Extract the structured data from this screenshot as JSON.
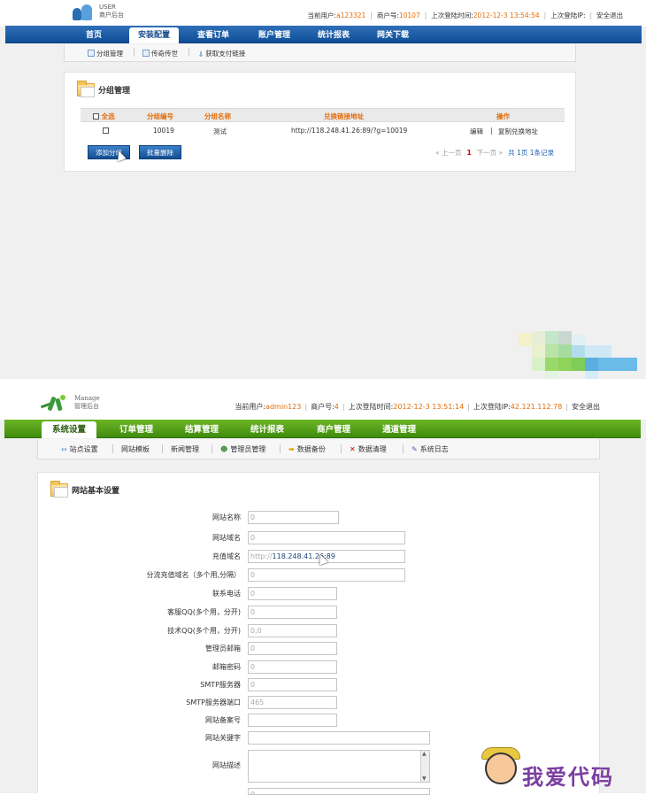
{
  "screen1": {
    "logo": {
      "line1": "USER",
      "line2": "商户后台"
    },
    "info": {
      "user_label": "当前用户:",
      "user_value": "a123321",
      "merchant_label": "商户号:",
      "merchant_value": "10107",
      "last_login_label": "上次登陆时间:",
      "last_login_value": "2012-12-3 13:54:54",
      "last_ip_label": "上次登陆IP:",
      "logout": "安全退出"
    },
    "nav": [
      "首页",
      "安装配置",
      "查看订单",
      "账户管理",
      "统计报表",
      "网关下载"
    ],
    "subnav": [
      "分组管理",
      "传奇传世",
      "获取支付链接"
    ],
    "panel_title": "分组管理",
    "table": {
      "headers": [
        "全选",
        "分组编号",
        "分组名称",
        "兑换链接地址",
        "操作"
      ],
      "rows": [
        {
          "id": "10019",
          "name": "测试",
          "url": "http://118.248.41.26:89/?g=10019",
          "edit": "编辑",
          "copy": "复制兑换地址"
        }
      ]
    },
    "buttons": {
      "add": "添加分组",
      "delete": "批量删除"
    },
    "pager": {
      "prev": "« 上一页",
      "current": "1",
      "next": "下一页 »",
      "total_prefix": "共",
      "total_pages": "1页",
      "total_records": "1条记录"
    }
  },
  "screen2": {
    "logo": {
      "line1": "Manage",
      "line2": "管理后台"
    },
    "info": {
      "user_label": "当前用户:",
      "user_value": "admin123",
      "merchant_label": "商户号:",
      "merchant_value": "4",
      "last_login_label": "上次登陆时间:",
      "last_login_value": "2012-12-3 13:51:14",
      "last_ip_label": "上次登陆IP:",
      "last_ip_value": "42.121.112.78",
      "logout": "安全退出"
    },
    "nav": [
      "系统设置",
      "订单管理",
      "结算管理",
      "统计报表",
      "商户管理",
      "通道管理"
    ],
    "subnav": [
      "站点设置",
      "网站模板",
      "新闻管理",
      "管理员管理",
      "数据备份",
      "数据清理",
      "系统日志"
    ],
    "panel_title": "网站基本设置",
    "fields": [
      {
        "label": "网站名称",
        "value": "0"
      },
      {
        "label": "网站域名",
        "value": "0"
      },
      {
        "label": "充值域名",
        "value": "http://",
        "domain": "118.248.41.26:89"
      },
      {
        "label": "分流充值域名（多个用,分隔）",
        "value": "0"
      },
      {
        "label": "联系电话",
        "value": "0"
      },
      {
        "label": "客服QQ(多个用，分开)",
        "value": "0"
      },
      {
        "label": "技术QQ(多个用，分开)",
        "value": "0,0"
      },
      {
        "label": "管理员邮箱",
        "value": "0"
      },
      {
        "label": "邮箱密码",
        "value": "0"
      },
      {
        "label": "SMTP服务器",
        "value": "0"
      },
      {
        "label": "SMTP服务器端口",
        "value": "465"
      },
      {
        "label": "网站备案号",
        "value": ""
      },
      {
        "label": "网站关键字",
        "value": ""
      },
      {
        "label": "网站描述",
        "value": ""
      }
    ],
    "partial_input_value": "0"
  },
  "watermark": {
    "text": "我爱代码"
  },
  "colors": {
    "blue_nav": "#1b5aa5",
    "green_nav": "#55a31a",
    "accent_orange": "#e36c09",
    "link_blue": "#1d5fb0"
  }
}
